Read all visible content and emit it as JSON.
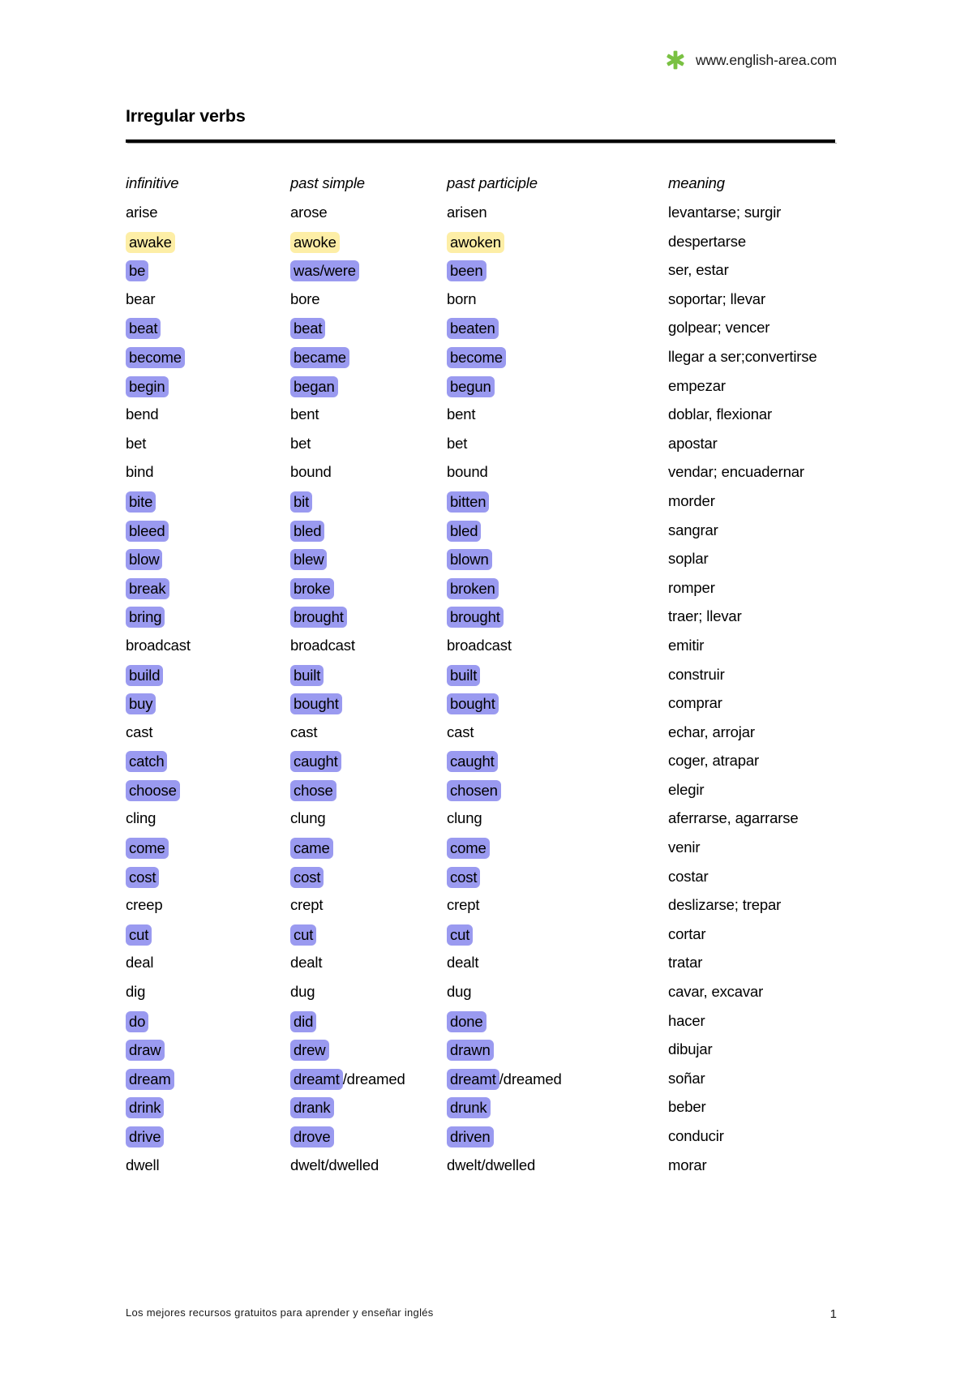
{
  "header": {
    "logo_icon": "green-asterisk-icon",
    "logo_color": "#7ac143",
    "url": "www.english-area.com"
  },
  "title": "Irregular verbs",
  "columns": {
    "infinitive": "infinitive",
    "past_simple": "past simple",
    "past_participle": "past participle",
    "meaning": "meaning"
  },
  "highlight_colors": {
    "purple": "#9a9af0",
    "yellow": "#fdeea6"
  },
  "rows": [
    {
      "infinitive": "arise",
      "past_simple": "arose",
      "past_participle": "arisen",
      "meaning": "levantarse; surgir",
      "highlight": "none"
    },
    {
      "infinitive": "awake",
      "past_simple": "awoke",
      "past_participle": "awoken",
      "meaning": "despertarse",
      "highlight": "yellow"
    },
    {
      "infinitive": "be",
      "past_simple": "was/were",
      "past_participle": "been",
      "meaning": "ser, estar",
      "highlight": "purple"
    },
    {
      "infinitive": "bear",
      "past_simple": "bore",
      "past_participle": "born",
      "meaning": "soportar; llevar",
      "highlight": "none"
    },
    {
      "infinitive": "beat",
      "past_simple": "beat",
      "past_participle": "beaten",
      "meaning": "golpear; vencer",
      "highlight": "purple"
    },
    {
      "infinitive": "become",
      "past_simple": "became",
      "past_participle": "become",
      "meaning": "llegar a ser;convertirse",
      "highlight": "purple"
    },
    {
      "infinitive": "begin",
      "past_simple": "began",
      "past_participle": "begun",
      "meaning": "empezar",
      "highlight": "purple"
    },
    {
      "infinitive": "bend",
      "past_simple": "bent",
      "past_participle": "bent",
      "meaning": "doblar, flexionar",
      "highlight": "none"
    },
    {
      "infinitive": "bet",
      "past_simple": "bet",
      "past_participle": "bet",
      "meaning": "apostar",
      "highlight": "none"
    },
    {
      "infinitive": "bind",
      "past_simple": "bound",
      "past_participle": "bound",
      "meaning": "vendar; encuadernar",
      "highlight": "none"
    },
    {
      "infinitive": "bite",
      "past_simple": "bit",
      "past_participle": "bitten",
      "meaning": "morder",
      "highlight": "purple"
    },
    {
      "infinitive": "bleed",
      "past_simple": "bled",
      "past_participle": "bled",
      "meaning": "sangrar",
      "highlight": "purple"
    },
    {
      "infinitive": "blow",
      "past_simple": "blew",
      "past_participle": "blown",
      "meaning": "soplar",
      "highlight": "purple"
    },
    {
      "infinitive": "break",
      "past_simple": "broke",
      "past_participle": "broken",
      "meaning": "romper",
      "highlight": "purple"
    },
    {
      "infinitive": "bring",
      "past_simple": "brought",
      "past_participle": "brought",
      "meaning": "traer; llevar",
      "highlight": "purple"
    },
    {
      "infinitive": "broadcast",
      "past_simple": "broadcast",
      "past_participle": "broadcast",
      "meaning": "emitir",
      "highlight": "none"
    },
    {
      "infinitive": "build",
      "past_simple": "built",
      "past_participle": "built",
      "meaning": "construir",
      "highlight": "purple"
    },
    {
      "infinitive": "buy",
      "past_simple": "bought",
      "past_participle": "bought",
      "meaning": "comprar",
      "highlight": "purple"
    },
    {
      "infinitive": "cast",
      "past_simple": "cast",
      "past_participle": "cast",
      "meaning": "echar, arrojar",
      "highlight": "none"
    },
    {
      "infinitive": "catch",
      "past_simple": "caught",
      "past_participle": "caught",
      "meaning": "coger, atrapar",
      "highlight": "purple"
    },
    {
      "infinitive": "choose",
      "past_simple": "chose",
      "past_participle": "chosen",
      "meaning": "elegir",
      "highlight": "purple"
    },
    {
      "infinitive": "cling",
      "past_simple": "clung",
      "past_participle": "clung",
      "meaning": "aferrarse, agarrarse",
      "highlight": "none"
    },
    {
      "infinitive": "come",
      "past_simple": "came",
      "past_participle": "come",
      "meaning": "venir",
      "highlight": "purple"
    },
    {
      "infinitive": "cost",
      "past_simple": "cost",
      "past_participle": "cost",
      "meaning": "costar",
      "highlight": "purple"
    },
    {
      "infinitive": "creep",
      "past_simple": "crept",
      "past_participle": "crept",
      "meaning": "deslizarse; trepar",
      "highlight": "none"
    },
    {
      "infinitive": "cut",
      "past_simple": "cut",
      "past_participle": "cut",
      "meaning": "cortar",
      "highlight": "purple"
    },
    {
      "infinitive": "deal",
      "past_simple": "dealt",
      "past_participle": "dealt",
      "meaning": "tratar",
      "highlight": "none"
    },
    {
      "infinitive": "dig",
      "past_simple": "dug",
      "past_participle": "dug",
      "meaning": "cavar, excavar",
      "highlight": "none"
    },
    {
      "infinitive": "do",
      "past_simple": "did",
      "past_participle": "done",
      "meaning": "hacer",
      "highlight": "purple"
    },
    {
      "infinitive": "draw",
      "past_simple": "drew",
      "past_participle": "drawn",
      "meaning": "dibujar",
      "highlight": "purple"
    },
    {
      "infinitive": "dream",
      "past_simple": "dreamt/dreamed",
      "past_participle": "dreamt/dreamed",
      "meaning": "soñar",
      "highlight": "purple",
      "partial": {
        "past_simple": "dreamt",
        "past_participle": "dreamt"
      }
    },
    {
      "infinitive": "drink",
      "past_simple": "drank",
      "past_participle": "drunk",
      "meaning": "beber",
      "highlight": "purple"
    },
    {
      "infinitive": "drive",
      "past_simple": "drove",
      "past_participle": "driven",
      "meaning": "conducir",
      "highlight": "purple"
    },
    {
      "infinitive": "dwell",
      "past_simple": "dwelt/dwelled",
      "past_participle": "dwelt/dwelled",
      "meaning": "morar",
      "highlight": "none"
    }
  ],
  "footer": {
    "note": "Los mejores recursos gratuitos para aprender y enseñar inglés",
    "page_number": "1"
  }
}
